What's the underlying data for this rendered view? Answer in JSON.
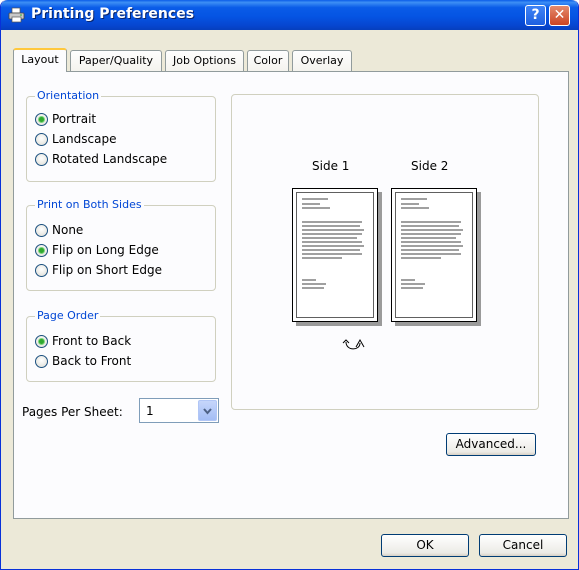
{
  "window": {
    "title": "Printing Preferences",
    "help_glyph": "?",
    "close_glyph": "✕"
  },
  "tabs": [
    {
      "label": "Layout",
      "active": true
    },
    {
      "label": "Paper/Quality",
      "active": false
    },
    {
      "label": "Job Options",
      "active": false
    },
    {
      "label": "Color",
      "active": false
    },
    {
      "label": "Overlay",
      "active": false
    }
  ],
  "orientation": {
    "title": "Orientation",
    "options": [
      {
        "label": "Portrait",
        "checked": true
      },
      {
        "label": "Landscape",
        "checked": false
      },
      {
        "label": "Rotated Landscape",
        "checked": false
      }
    ]
  },
  "duplex": {
    "title": "Print on Both Sides",
    "options": [
      {
        "label": "None",
        "checked": false
      },
      {
        "label": "Flip on Long Edge",
        "checked": true
      },
      {
        "label": "Flip on Short Edge",
        "checked": false
      }
    ]
  },
  "page_order": {
    "title": "Page Order",
    "options": [
      {
        "label": "Front to Back",
        "checked": true
      },
      {
        "label": "Back to Front",
        "checked": false
      }
    ]
  },
  "pages_per_sheet": {
    "label": "Pages Per Sheet:",
    "value": "1"
  },
  "preview": {
    "side1_label": "Side 1",
    "side2_label": "Side 2"
  },
  "buttons": {
    "advanced": "Advanced...",
    "ok": "OK",
    "cancel": "Cancel"
  },
  "colors": {
    "titlebar": "#0554e3",
    "group_title": "#0046d5",
    "dialog_bg": "#ece9d8",
    "radio_checked": "#2fa82f"
  }
}
